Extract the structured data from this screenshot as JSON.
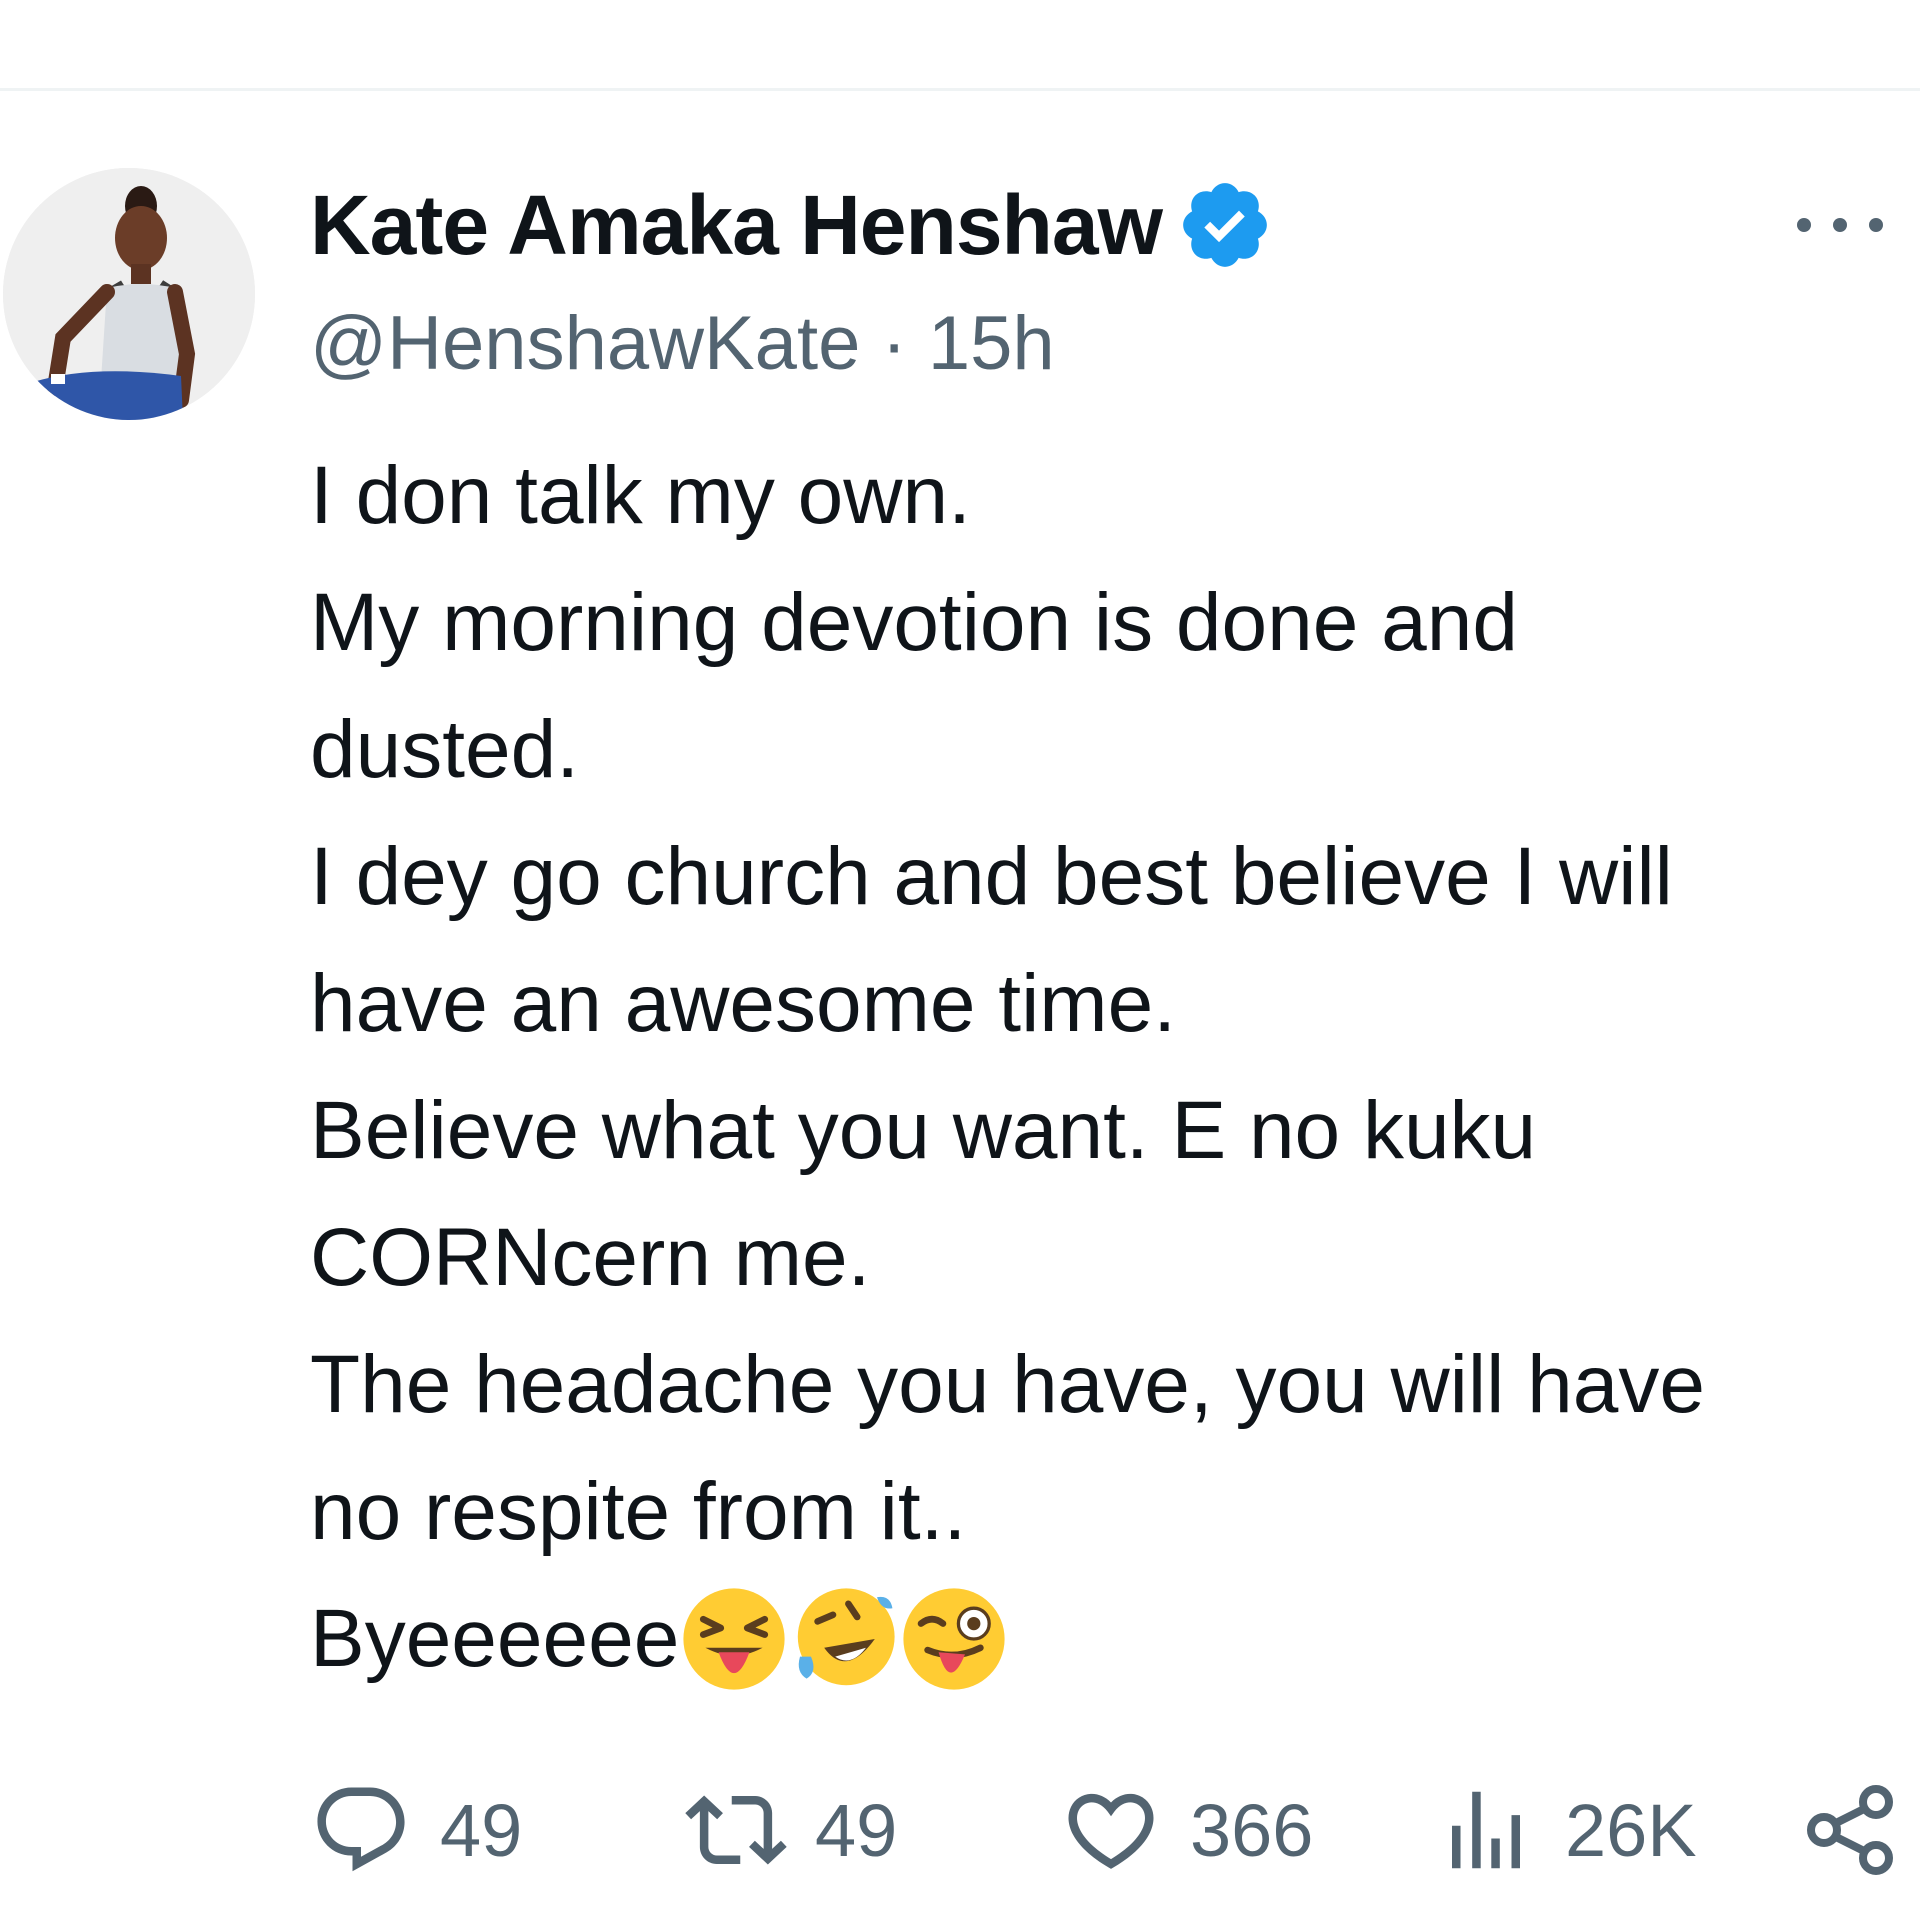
{
  "tweet": {
    "author": {
      "display_name": "Kate Amaka Henshaw",
      "handle": "@HenshawKate",
      "verified": true,
      "avatar_icon": "avatar-photo"
    },
    "separator": " · ",
    "time_ago": "15h",
    "body_lines": [
      "I don talk my own.",
      "My morning devotion is done and",
      "dusted.",
      "I dey go church and best believe I will",
      "have an awesome time.",
      "Believe what you want. E no kuku",
      "CORNcern me.",
      "The headache you have, you will have",
      "no respite from it.."
    ],
    "last_line_text": "Byeeeeee",
    "emojis": [
      "squinting-face-with-tongue",
      "rolling-on-floor-laughing",
      "zany-face"
    ],
    "actions": {
      "replies": "49",
      "reposts": "49",
      "likes": "366",
      "views": "26K"
    },
    "icons": {
      "reply": "speech-bubble-icon",
      "repost": "repost-arrows-icon",
      "like": "heart-icon",
      "views": "bar-chart-icon",
      "share": "share-icon",
      "more": "more-dots-icon",
      "verified": "verified-badge-icon"
    },
    "colors": {
      "text": "#0f1419",
      "muted": "#536471",
      "verified": "#1d9bf0"
    }
  }
}
